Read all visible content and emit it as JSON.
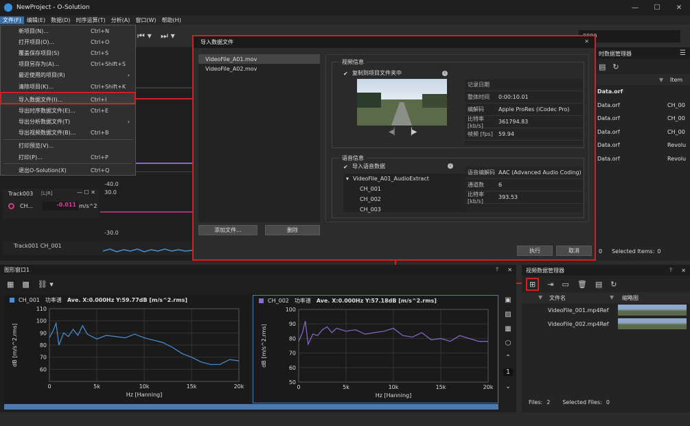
{
  "app": {
    "title": "NewProject - O-Solution"
  },
  "menu": [
    {
      "label": "文件(F)",
      "active": true
    },
    {
      "label": "编辑(E)"
    },
    {
      "label": "数据(D)"
    },
    {
      "label": "时序运算(T)"
    },
    {
      "label": "分析(A)"
    },
    {
      "label": "窗口(W)"
    },
    {
      "label": "帮助(H)"
    }
  ],
  "file_menu": [
    {
      "label": "新项目(N)...",
      "shortcut": "Ctrl+N"
    },
    {
      "label": "打开项目(O)...",
      "shortcut": "Ctrl+O"
    },
    {
      "label": "覆盖保存项目(S)",
      "shortcut": "Ctrl+S"
    },
    {
      "label": "项目另存为(A)...",
      "shortcut": "Ctrl+Shift+S"
    },
    {
      "label": "最近使用的项目(R)",
      "shortcut": "",
      "submenu": true
    },
    {
      "label": "清除项目(K)...",
      "shortcut": "Ctrl+Shift+K"
    },
    {
      "sep": true
    },
    {
      "label": "导入数据文件(I)...",
      "shortcut": "Ctrl+I",
      "highlight": true
    },
    {
      "label": "导出时序数据文件(E)...",
      "shortcut": "Ctrl+E"
    },
    {
      "label": "导出分析数据文件(T)",
      "shortcut": "",
      "submenu": true
    },
    {
      "label": "导出视频数据文件(B)...",
      "shortcut": "Ctrl+B"
    },
    {
      "sep": true
    },
    {
      "label": "打印预览(V)...",
      "shortcut": ""
    },
    {
      "label": "打印(P)...",
      "shortcut": "Ctrl+P"
    },
    {
      "sep": true
    },
    {
      "label": "退出O-Solution(X)",
      "shortcut": "Ctrl+Q"
    }
  ],
  "toolbar": {
    "time_value": "0000"
  },
  "track": {
    "name": "Track003",
    "channel": "CH...",
    "value": "-0.011",
    "unit": "m/s^2",
    "ticks": [
      "-40.0",
      "30.0",
      "-30.0"
    ],
    "bottom_label": "Track001 CH_001"
  },
  "dialog": {
    "title": "导入数据文件",
    "files": [
      "VideoFile_A01.mov",
      "VideoFile_A02.mov"
    ],
    "add_button": "添加文件...",
    "delete_button": "删除",
    "video_group": "视频信息",
    "copy_checkbox": "复制到项目文件夹中",
    "video_info": [
      {
        "k": "记录日期",
        "v": ""
      },
      {
        "k": "整体时间",
        "v": "0:00:10.01"
      },
      {
        "k": "编解码",
        "v": "Apple ProRes (iCodec Pro)"
      },
      {
        "k": "比特率 [kb/s]",
        "v": "361794.83"
      },
      {
        "k": "帧频 [fps]",
        "v": "59.94"
      }
    ],
    "audio_group": "语音信息",
    "audio_checkbox": "导入语音数据",
    "audio_tree": {
      "root": "VideoFile_A01_AudioExtract",
      "children": [
        "CH_001",
        "CH_002",
        "CH_003"
      ]
    },
    "audio_info": [
      {
        "k": "语音编解码",
        "v": "AAC (Advanced Audio Coding)"
      },
      {
        "k": "通道数",
        "v": "6"
      },
      {
        "k": "比特率 [kb/s]",
        "v": "393.53"
      }
    ],
    "ok_button": "执行",
    "cancel_button": "取消"
  },
  "right_panel": {
    "title": "时数据管理器",
    "col_item": "Item",
    "rows": [
      {
        "name": "Data.orf",
        "item": ""
      },
      {
        "name": "Data.orf",
        "item": "CH_00"
      },
      {
        "name": "Data.orf",
        "item": "CH_00"
      },
      {
        "name": "Data.orf",
        "item": "CH_00"
      },
      {
        "name": "Data.orf",
        "item": "Revolu"
      },
      {
        "name": "Data.orf",
        "item": "Revolu"
      }
    ],
    "status": "Selected Items:",
    "count": "0",
    "count_left": "0"
  },
  "graph_window": {
    "title": "图形窗口1",
    "charts": [
      {
        "channel": "CH_001",
        "kind": "功率谱",
        "stats": "Ave. X:0.000Hz Y:59.77dB [m/s^2.rms]",
        "color": "#4a90d9"
      },
      {
        "channel": "CH_002",
        "kind": "功率谱",
        "stats": "Ave. X:0.000Hz Y:57.18dB [m/s^2.rms]",
        "color": "#8a6ad0"
      }
    ],
    "side_page": "1"
  },
  "chart_data": [
    {
      "type": "line",
      "title": "",
      "xlabel": "Hz [Hanning]",
      "ylabel": "dB [m/s^2.rms]",
      "xlim": [
        0,
        20000
      ],
      "ylim": [
        50,
        110
      ],
      "xticks": [
        "0",
        "5k",
        "10k",
        "15k",
        "20k"
      ],
      "yticks": [
        "60",
        "70",
        "80",
        "90",
        "100",
        "110"
      ],
      "series": [
        {
          "name": "CH_001",
          "x": [
            0,
            400,
            700,
            1000,
            1500,
            2000,
            2500,
            3000,
            3500,
            4000,
            5000,
            6000,
            7000,
            8000,
            9000,
            10000,
            11000,
            12000,
            13000,
            14000,
            15000,
            16000,
            17000,
            18000,
            19000,
            20000
          ],
          "y": [
            86,
            92,
            98,
            80,
            90,
            87,
            93,
            88,
            96,
            89,
            85,
            88,
            87,
            86,
            89,
            86,
            84,
            82,
            78,
            73,
            70,
            66,
            64,
            64,
            68,
            67
          ]
        }
      ]
    },
    {
      "type": "line",
      "title": "",
      "xlabel": "Hz [Hanning]",
      "ylabel": "dB [m/s^2.rms]",
      "xlim": [
        0,
        20000
      ],
      "ylim": [
        50,
        100
      ],
      "xticks": [
        "0",
        "5k",
        "10k",
        "15k",
        "20k"
      ],
      "yticks": [
        "50",
        "60",
        "70",
        "80",
        "90",
        "100"
      ],
      "series": [
        {
          "name": "CH_002",
          "x": [
            0,
            400,
            700,
            1000,
            1500,
            2000,
            2500,
            3000,
            3500,
            4000,
            5000,
            6000,
            7000,
            8000,
            9000,
            10000,
            11000,
            12000,
            13000,
            14000,
            15000,
            16000,
            17000,
            18000,
            19000,
            20000
          ],
          "y": [
            78,
            84,
            92,
            76,
            83,
            82,
            86,
            88,
            84,
            87,
            85,
            86,
            83,
            84,
            85,
            87,
            82,
            81,
            84,
            79,
            80,
            78,
            82,
            80,
            78,
            78
          ]
        }
      ]
    }
  ],
  "video_mgr": {
    "title": "视频数据管理器",
    "col_file": "文件名",
    "col_thumb": "缩略图",
    "files": [
      "VideoFile_001.mp4Ref",
      "VideoFile_002.mp4Ref"
    ],
    "files_label": "Files:",
    "files_count": "2",
    "selected_label": "Selected Files:",
    "selected_count": "0"
  }
}
